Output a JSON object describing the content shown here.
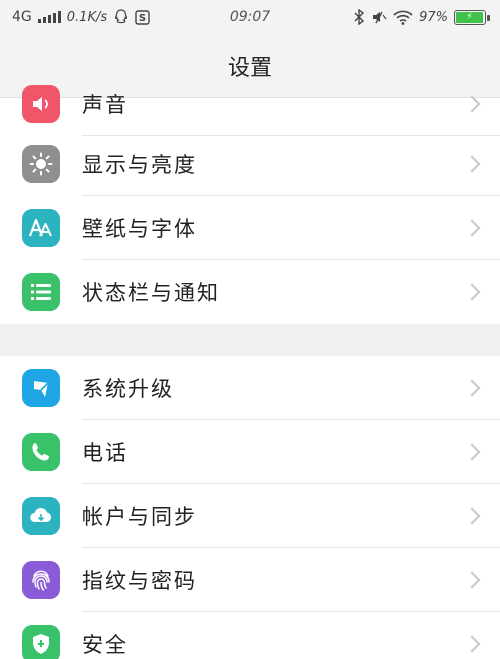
{
  "status_bar": {
    "network": "4G",
    "speed": "0.1K/s",
    "time": "09:07",
    "battery_percent": "97%",
    "battery_level": 0.97,
    "battery_color": "#3fc34a"
  },
  "header": {
    "title": "设置"
  },
  "group1": {
    "items": [
      {
        "label": "声音",
        "icon": "sound-icon",
        "color": "#f0556a"
      },
      {
        "label": "显示与亮度",
        "icon": "brightness-icon",
        "color": "#8f8f8f"
      },
      {
        "label": "壁纸与字体",
        "icon": "font-icon",
        "color": "#2bb3c0"
      },
      {
        "label": "状态栏与通知",
        "icon": "notification-list-icon",
        "color": "#3ac26a"
      }
    ]
  },
  "group2": {
    "items": [
      {
        "label": "系统升级",
        "icon": "system-update-icon",
        "color": "#1ea5e6"
      },
      {
        "label": "电话",
        "icon": "phone-icon",
        "color": "#3ac26a"
      },
      {
        "label": "帐户与同步",
        "icon": "cloud-sync-icon",
        "color": "#2bb3c0"
      },
      {
        "label": "指纹与密码",
        "icon": "fingerprint-icon",
        "color": "#8a5bd6"
      },
      {
        "label": "安全",
        "icon": "shield-icon",
        "color": "#3ac26a"
      }
    ]
  }
}
